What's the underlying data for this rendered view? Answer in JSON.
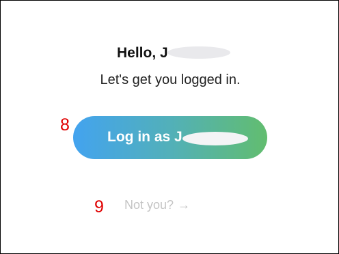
{
  "greeting": {
    "hello": "Hello, J",
    "subtitle": "Let's get you logged in."
  },
  "login_button": {
    "label": "Log in as J"
  },
  "not_you_link": {
    "label": "Not you?",
    "arrow": "→"
  },
  "annotations": {
    "login_marker": "8",
    "not_you_marker": "9"
  },
  "colors": {
    "gradient_start": "#43a3ef",
    "gradient_end": "#62bd6f",
    "marker": "#e00000",
    "link": "#c4c4c4"
  }
}
